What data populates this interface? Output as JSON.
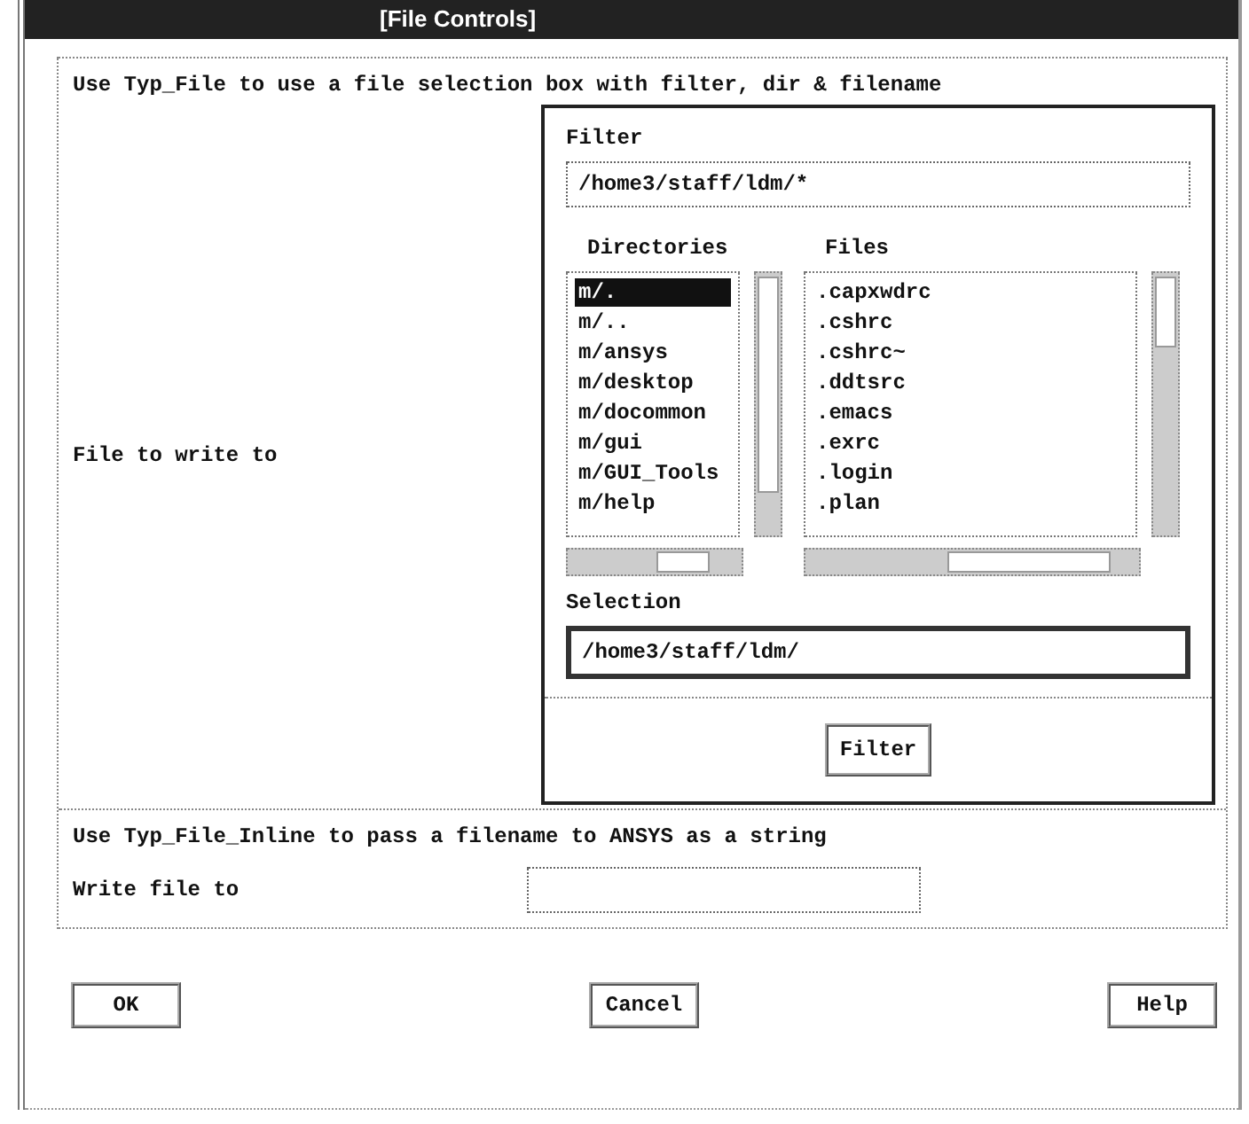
{
  "window": {
    "title": "[File Controls]"
  },
  "file_section": {
    "description": "Use Typ_File to use a file selection box with filter, dir & filename",
    "label": "File to write to",
    "filter": {
      "label": "Filter",
      "value": "/home3/staff/ldm/*"
    },
    "directories": {
      "label": "Directories",
      "items": [
        {
          "text": "m/.",
          "selected": true
        },
        {
          "text": "m/..",
          "selected": false
        },
        {
          "text": "m/ansys",
          "selected": false
        },
        {
          "text": "m/desktop",
          "selected": false
        },
        {
          "text": "m/docommon",
          "selected": false
        },
        {
          "text": "m/gui",
          "selected": false
        },
        {
          "text": "m/GUI_Tools",
          "selected": false
        },
        {
          "text": "m/help",
          "selected": false
        }
      ]
    },
    "files": {
      "label": "Files",
      "items": [
        ".capxwdrc",
        ".cshrc",
        ".cshrc~",
        ".ddtsrc",
        ".emacs",
        ".exrc",
        ".login",
        ".plan"
      ]
    },
    "selection": {
      "label": "Selection",
      "value": "/home3/staff/ldm/"
    },
    "filter_button": "Filter"
  },
  "inline_section": {
    "description": "Use Typ_File_Inline to pass a filename to ANSYS as a string",
    "label": "Write file to"
  },
  "buttons": [
    "OK",
    "Cancel",
    "Help"
  ]
}
